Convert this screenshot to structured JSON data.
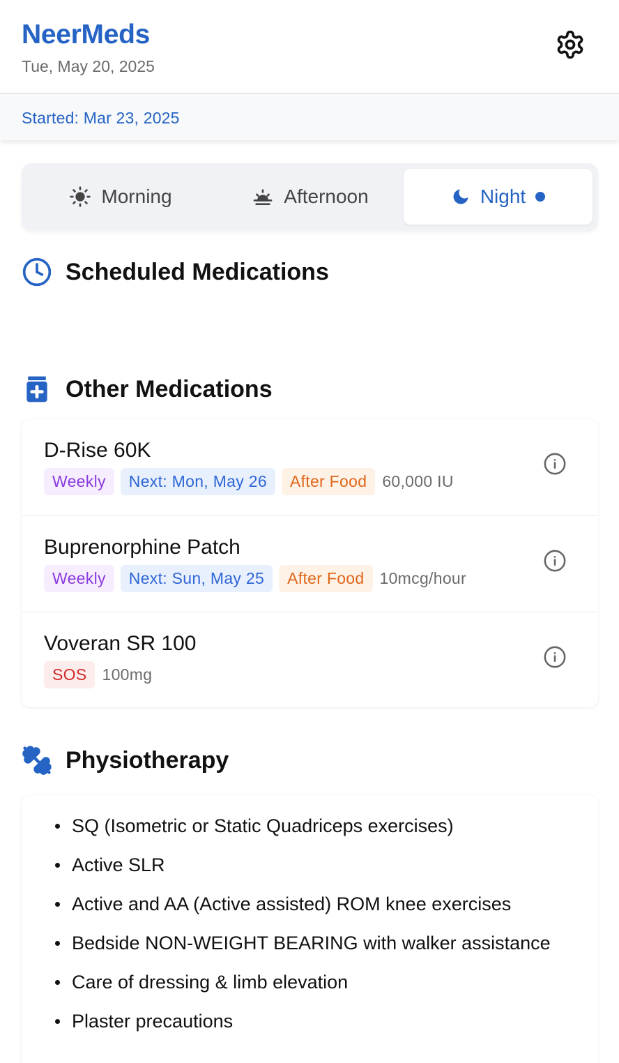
{
  "header": {
    "app_title": "NeerMeds",
    "date": "Tue, May 20, 2025",
    "settings_icon": "gear-icon"
  },
  "started": {
    "text": "Started: Mar 23, 2025"
  },
  "tabs": [
    {
      "label": "Morning",
      "icon": "sun-icon",
      "active": false
    },
    {
      "label": "Afternoon",
      "icon": "sunset-icon",
      "active": false
    },
    {
      "label": "Night",
      "icon": "moon-icon",
      "active": true
    }
  ],
  "sections": {
    "scheduled": {
      "title": "Scheduled Medications",
      "icon": "clock-icon"
    },
    "other": {
      "title": "Other Medications",
      "icon": "medicine-bottle-icon"
    },
    "physio": {
      "title": "Physiotherapy",
      "icon": "dumbbell-icon"
    }
  },
  "other_medications": [
    {
      "name": "D-Rise 60K",
      "frequency": "Weekly",
      "next": "Next: Mon, May 26",
      "timing": "After Food",
      "dose": "60,000 IU"
    },
    {
      "name": "Buprenorphine Patch",
      "frequency": "Weekly",
      "next": "Next: Sun, May 25",
      "timing": "After Food",
      "dose": "10mcg/hour"
    },
    {
      "name": "Voveran SR 100",
      "frequency": "SOS",
      "dose": "100mg"
    }
  ],
  "physiotherapy": [
    "SQ (Isometric or Static Quadriceps exercises)",
    "Active SLR",
    "Active and AA (Active assisted) ROM knee exercises",
    "Bedside NON-WEIGHT BEARING with walker assistance",
    "Care of dressing & limb elevation",
    "Plaster precautions"
  ],
  "colors": {
    "accent": "#2563c4",
    "weekly": "#8b3bdf",
    "next": "#2f66d6",
    "food": "#e0661a",
    "sos": "#d42a2a"
  }
}
